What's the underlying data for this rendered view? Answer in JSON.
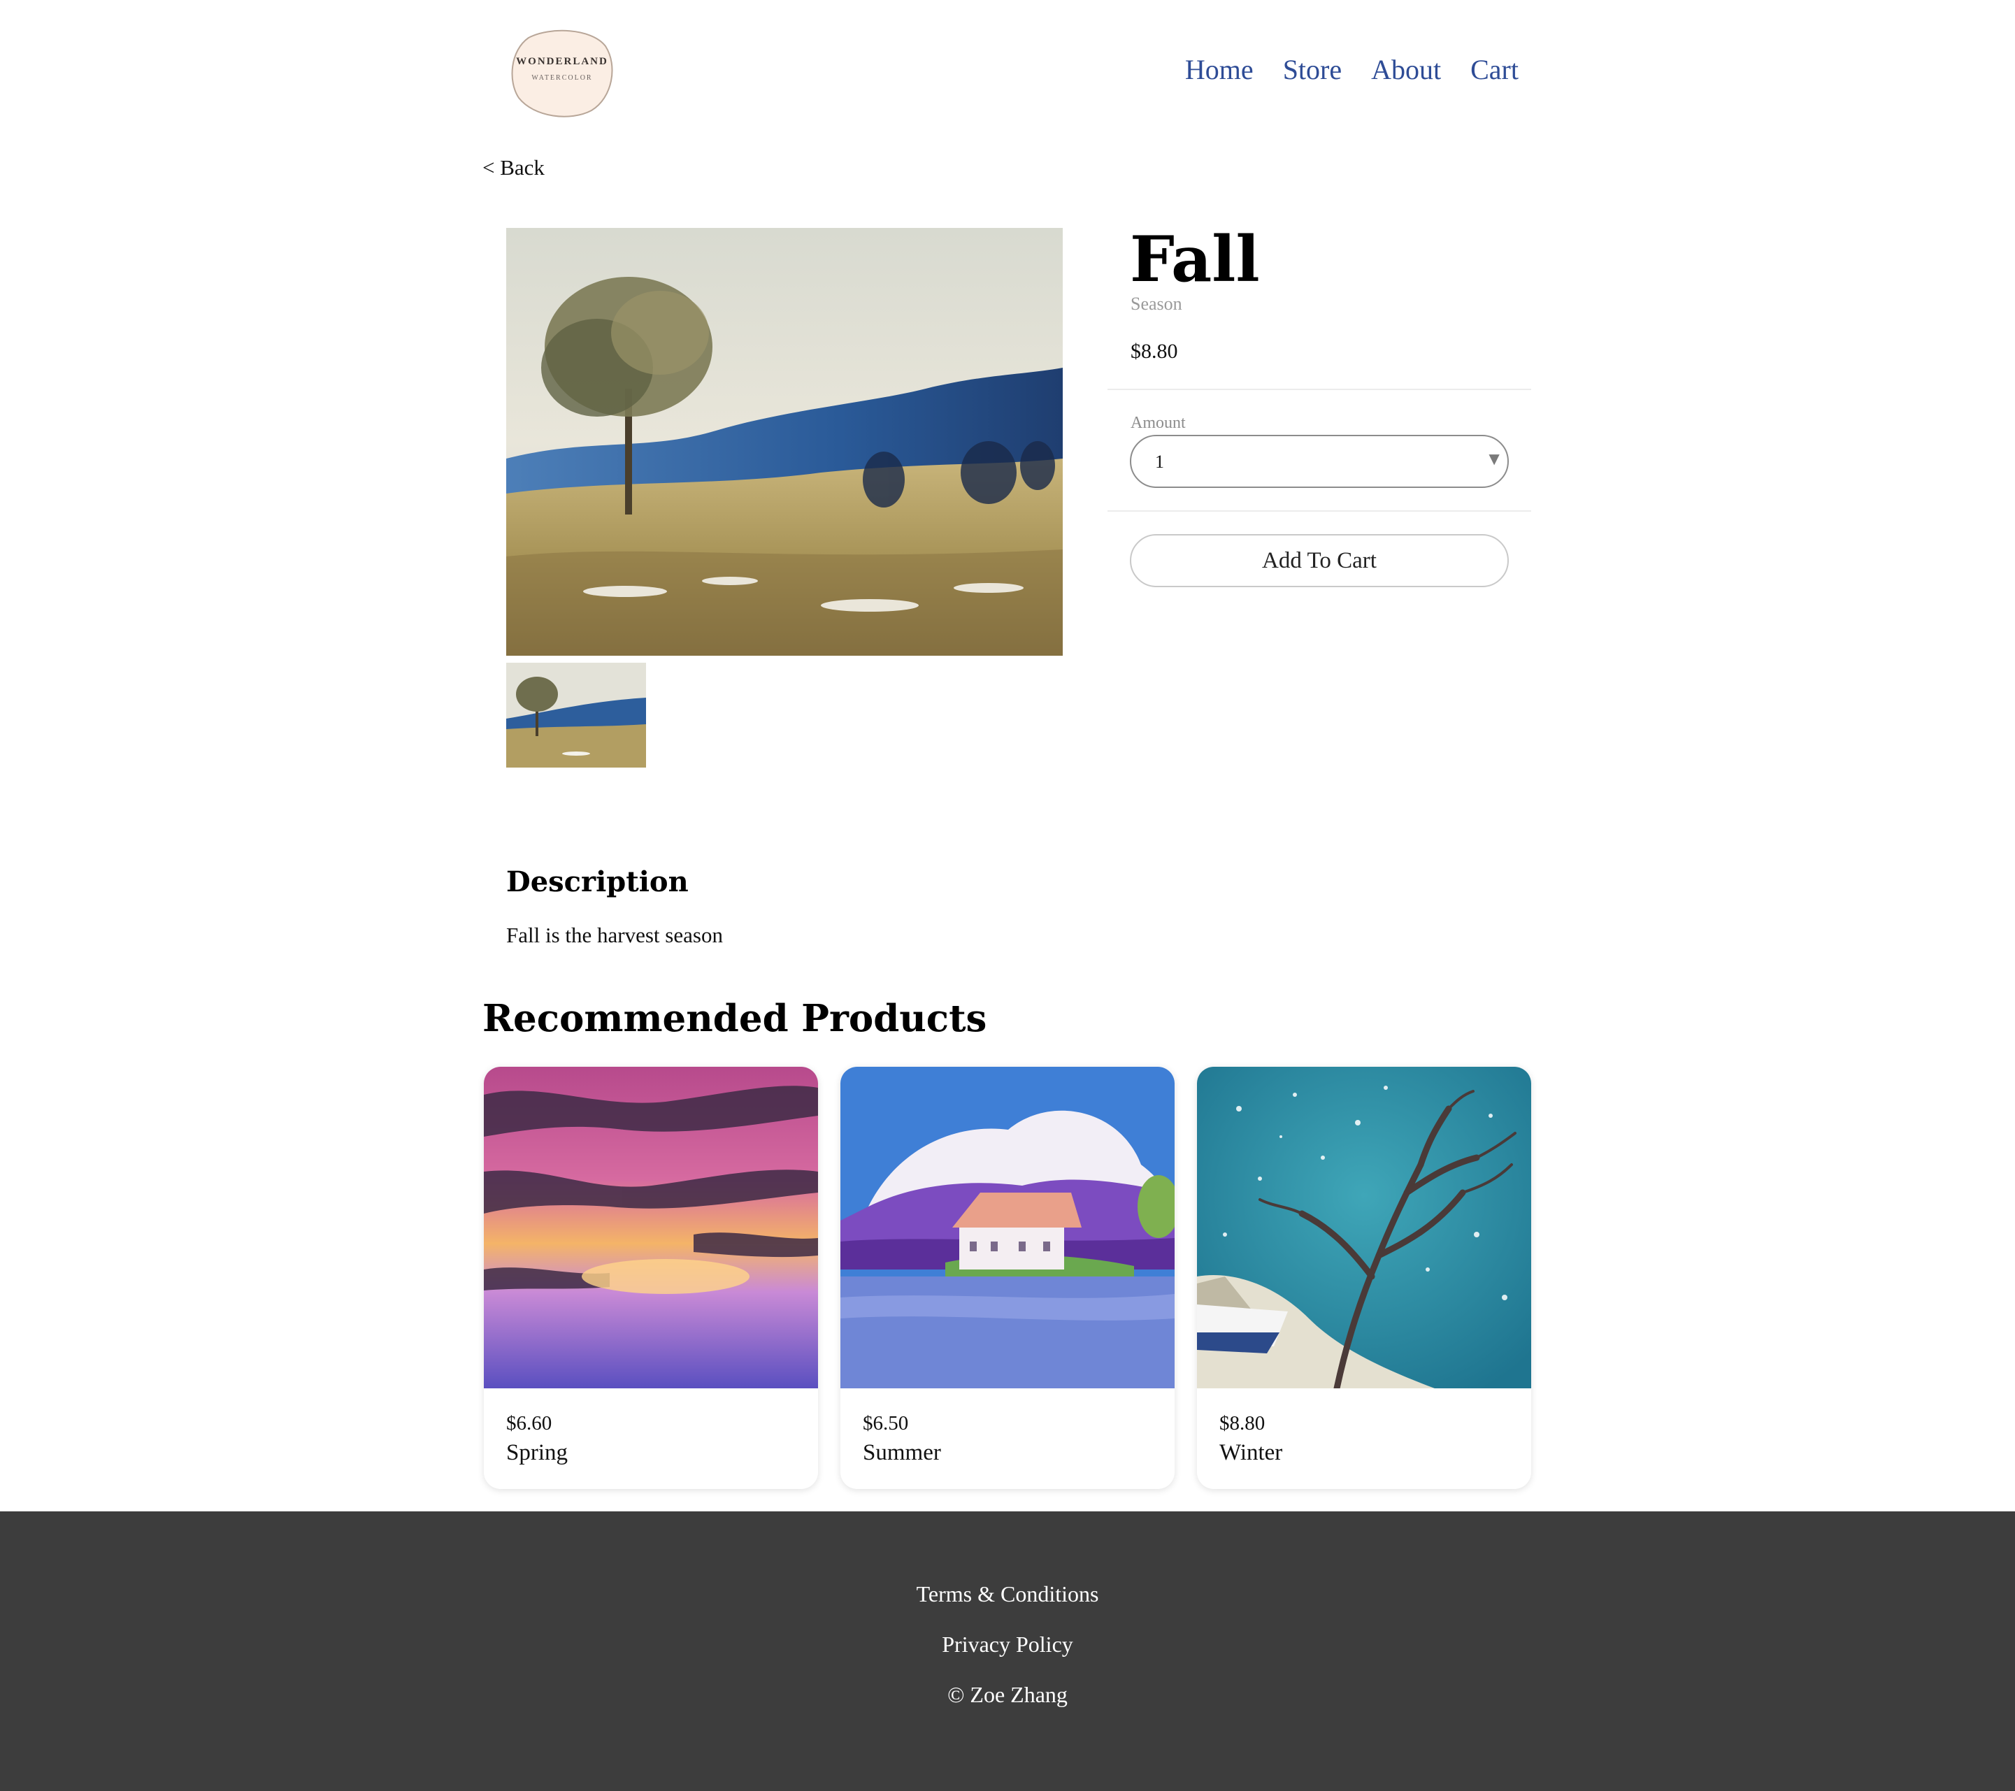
{
  "header": {
    "logo": {
      "line1": "WONDERLAND",
      "line2": "WATERCOLOR",
      "fill": "#fbeee4",
      "stroke": "#c9b8a8"
    },
    "nav": [
      "Home",
      "Store",
      "About",
      "Cart"
    ],
    "nav_color": "#2e4c96"
  },
  "back_link": "< Back",
  "product": {
    "title": "Fall",
    "category": "Season",
    "price": "$8.80",
    "amount_label": "Amount",
    "amount_value": "1",
    "select_arrow": "▼",
    "add_to_cart": "Add To Cart",
    "image": "autumn field watercolor landscape",
    "thumbnail": "autumn field watercolor landscape thumbnail"
  },
  "description": {
    "title": "Description",
    "text": "Fall is the harvest season"
  },
  "recommended": {
    "title": "Recommended Products",
    "items": [
      {
        "price": "$6.60",
        "name": "Spring",
        "image": "purple sunset sky watercolor"
      },
      {
        "price": "$6.50",
        "name": "Summer",
        "image": "house by lake watercolor"
      },
      {
        "price": "$8.80",
        "name": "Winter",
        "image": "snowy tree with boat watercolor"
      }
    ]
  },
  "footer": {
    "background": "#3d3d3d",
    "links": [
      "Terms & Conditions",
      "Privacy Policy",
      "© Zoe Zhang"
    ]
  }
}
